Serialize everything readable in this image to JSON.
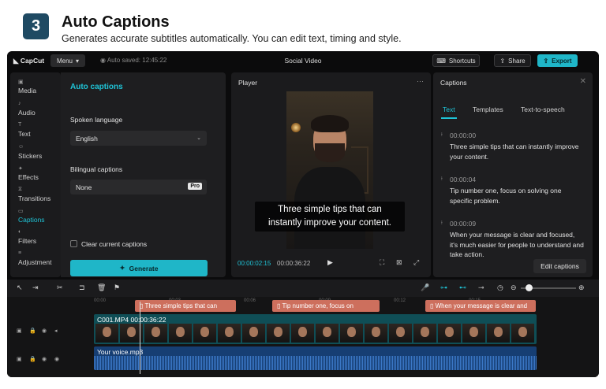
{
  "header": {
    "step": "3",
    "title": "Auto Captions",
    "subtitle": "Generates accurate subtitles automatically. You can edit text, timing and style."
  },
  "topbar": {
    "logo": "CapCut",
    "menu": "Menu",
    "autosave": "Auto saved: 12:45:22",
    "project": "Social Video",
    "shortcuts": "Shortcuts",
    "share": "Share",
    "export": "Export"
  },
  "sidebar": {
    "items": [
      {
        "label": "Media",
        "icon": "media-icon"
      },
      {
        "label": "Audio",
        "icon": "audio-icon"
      },
      {
        "label": "Text",
        "icon": "text-icon"
      },
      {
        "label": "Stickers",
        "icon": "stickers-icon"
      },
      {
        "label": "Effects",
        "icon": "effects-icon"
      },
      {
        "label": "Transitions",
        "icon": "transitions-icon"
      },
      {
        "label": "Captions",
        "icon": "captions-icon"
      },
      {
        "label": "Filters",
        "icon": "filters-icon"
      },
      {
        "label": "Adjustment",
        "icon": "adjustment-icon"
      }
    ],
    "active": "Captions"
  },
  "auto_captions": {
    "title": "Auto captions",
    "spoken_label": "Spoken language",
    "spoken_value": "English",
    "bilingual_label": "Bilingual captions",
    "bilingual_value": "None",
    "pro": "Pro",
    "clear_label": "Clear current captions",
    "generate": "Generate"
  },
  "player": {
    "title": "Player",
    "subtitle_line1": "Three simple tips that can",
    "subtitle_line2": "instantly improve your content.",
    "current_time": "00:00:02:15",
    "total_time": "00:00:36:22"
  },
  "captions_panel": {
    "title": "Captions",
    "tabs": [
      "Text",
      "Templates",
      "Text-to-speech"
    ],
    "entries": [
      {
        "time": "00:00:00",
        "text": "Three simple tips that can instantly improve your content."
      },
      {
        "time": "00:00:04",
        "text": "Tip number one, focus on solving one specific problem."
      },
      {
        "time": "00:00:09",
        "text": "When your message is clear and focused, it's much easier for people to understand and take action."
      }
    ],
    "edit_button": "Edit captions"
  },
  "timeline": {
    "ticks": [
      "00:00",
      "00:03",
      "00:06",
      "00:09",
      "00:12",
      "00:15"
    ],
    "caption_clips": [
      "Three simple tips that can",
      "Tip number one, focus on",
      "When your message is clear and"
    ],
    "video_clip": "C001.MP4  00:00:36:22",
    "audio_clip": "Your voice.mp3"
  },
  "colors": {
    "accent": "#1fc3d6",
    "caption_clip": "#cd6f5d",
    "video_track": "#0f4e56",
    "audio_track": "#163e73"
  }
}
